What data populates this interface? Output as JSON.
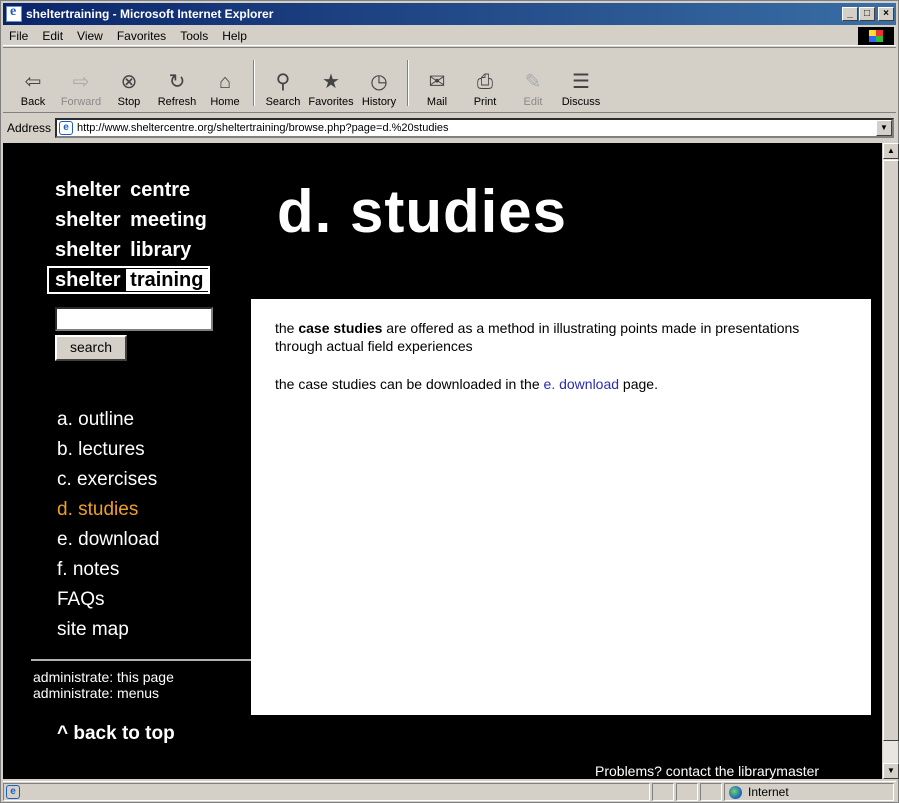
{
  "window": {
    "title": "sheltertraining - Microsoft Internet Explorer",
    "buttons": {
      "minimize": "_",
      "maximize": "□",
      "close": "×"
    }
  },
  "menubar": {
    "items": [
      "File",
      "Edit",
      "View",
      "Favorites",
      "Tools",
      "Help"
    ]
  },
  "toolbar": {
    "buttons": [
      {
        "label": "Back",
        "icon": "back-arrow-icon",
        "glyph": "⇦",
        "enabled": true
      },
      {
        "label": "Forward",
        "icon": "forward-arrow-icon",
        "glyph": "⇨",
        "enabled": false
      },
      {
        "label": "Stop",
        "icon": "stop-icon",
        "glyph": "⊗",
        "enabled": true
      },
      {
        "label": "Refresh",
        "icon": "refresh-icon",
        "glyph": "↻",
        "enabled": true
      },
      {
        "label": "Home",
        "icon": "home-icon",
        "glyph": "⌂",
        "enabled": true
      },
      {
        "label": "Search",
        "icon": "search-icon",
        "glyph": "⚲",
        "enabled": true
      },
      {
        "label": "Favorites",
        "icon": "favorites-icon",
        "glyph": "★",
        "enabled": true
      },
      {
        "label": "History",
        "icon": "history-icon",
        "glyph": "◷",
        "enabled": true
      },
      {
        "label": "Mail",
        "icon": "mail-icon",
        "glyph": "✉",
        "enabled": true
      },
      {
        "label": "Print",
        "icon": "print-icon",
        "glyph": "⎙",
        "enabled": true
      },
      {
        "label": "Edit",
        "icon": "edit-icon",
        "glyph": "✎",
        "enabled": false
      },
      {
        "label": "Discuss",
        "icon": "discuss-icon",
        "glyph": "☰",
        "enabled": true
      }
    ]
  },
  "address": {
    "label": "Address",
    "url": "http://www.sheltercentre.org/sheltertraining/browse.php?page=d.%20studies"
  },
  "site_nav": {
    "items": [
      "shelter centre",
      "shelter meeting",
      "shelter library"
    ],
    "active_prefix": "shelter",
    "active_suffix": "training"
  },
  "page": {
    "heading": "d. studies",
    "search_button": "search",
    "search_value": "",
    "back_to_top": "^ back to top",
    "footer": "Problems? contact the librarymaster"
  },
  "section_nav": {
    "items": [
      "a. outline",
      "b. lectures",
      "c. exercises",
      "d. studies",
      "e. download",
      "f. notes",
      "FAQs",
      "site map"
    ],
    "current": "d. studies"
  },
  "admin": {
    "this_page": "administrate: this page",
    "menus": "administrate: menus"
  },
  "content": {
    "p1_before": "the ",
    "p1_bold": "case studies",
    "p1_after": " are offered as a method in illustrating points made in presentations through actual field experiences",
    "p2_before": "the case studies can be downloaded in the ",
    "p2_link": "e. download",
    "p2_after": " page."
  },
  "status": {
    "zone": "Internet"
  },
  "colors": {
    "background": "#000000",
    "current_nav": "#f0a020",
    "link": "#2b2bae"
  }
}
